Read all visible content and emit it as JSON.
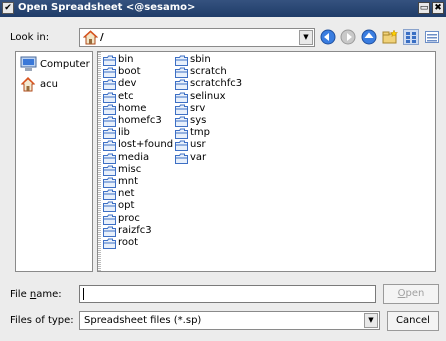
{
  "window": {
    "title": "Open Spreadsheet <@sesamo>",
    "menu_glyph": "✔",
    "max_glyph": "▭",
    "close_glyph": "✖"
  },
  "lookin": {
    "label": "Look in:",
    "path": "/"
  },
  "sidebar": {
    "items": [
      {
        "label": "Computer",
        "icon": "computer-icon"
      },
      {
        "label": "acu",
        "icon": "home-icon"
      }
    ]
  },
  "files": [
    "bin",
    "boot",
    "dev",
    "etc",
    "home",
    "homefc3",
    "lib",
    "lost+found",
    "media",
    "misc",
    "mnt",
    "net",
    "opt",
    "proc",
    "raizfc3",
    "root",
    "sbin",
    "scratch",
    "scratchfc3",
    "selinux",
    "srv",
    "sys",
    "tmp",
    "usr",
    "var"
  ],
  "filename": {
    "label": "File name:",
    "value": ""
  },
  "filetype": {
    "label": "Files of type:",
    "selected": "Spreadsheet files (*.sp)"
  },
  "buttons": {
    "open": "Open",
    "cancel": "Cancel"
  },
  "colors": {
    "titlebar": "#1f3c68",
    "nav_blue": "#2f6fd6",
    "folder_blue": "#3d6fc4"
  }
}
